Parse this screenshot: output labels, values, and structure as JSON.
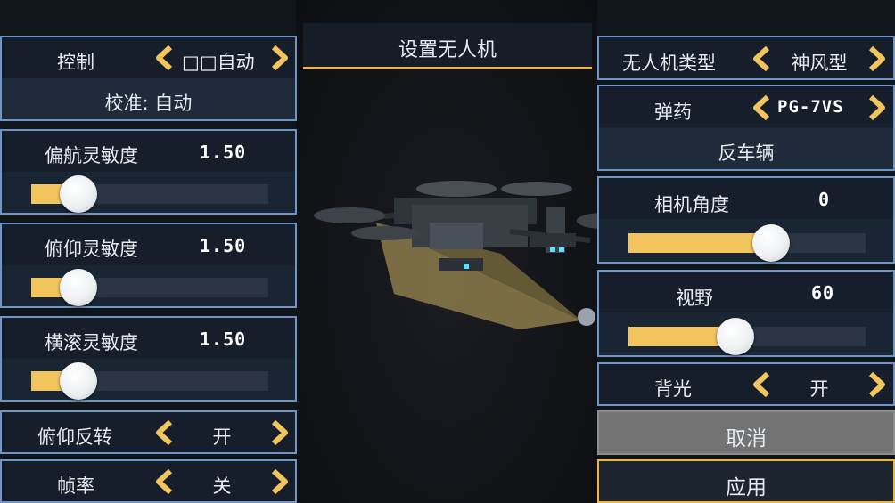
{
  "title": "设置无人机",
  "left": {
    "control": {
      "label": "控制",
      "value": "□□自动",
      "subtext": "校准: 自动"
    },
    "yaw": {
      "label": "偏航灵敏度",
      "value": "1.50",
      "level": 0.2
    },
    "pitch": {
      "label": "俯仰灵敏度",
      "value": "1.50",
      "level": 0.2
    },
    "roll": {
      "label": "横滚灵敏度",
      "value": "1.50",
      "level": 0.2
    },
    "pitch_invert": {
      "label": "俯仰反转",
      "value": "开"
    },
    "framerate": {
      "label": "帧率",
      "value": "关"
    }
  },
  "right": {
    "drone_type": {
      "label": "无人机类型",
      "value": "神风型"
    },
    "ammo": {
      "label": "弹药",
      "value": "PG-7VS",
      "subtext": "反车辆"
    },
    "camera_angle": {
      "label": "相机角度",
      "value": "0",
      "level": 0.6
    },
    "fov": {
      "label": "视野",
      "value": "60",
      "level": 0.45
    },
    "backlight": {
      "label": "背光",
      "value": "开"
    },
    "cancel": "取消",
    "apply": "应用"
  },
  "icons": {
    "left_arrow": "chevron-left-icon",
    "right_arrow": "chevron-right-icon"
  },
  "colors": {
    "accent": "#f2c45d",
    "panel_border": "#6f95c7",
    "panel_bg": "#1a2533",
    "cancel_bg": "#737373",
    "apply_border": "#f0b43c"
  }
}
